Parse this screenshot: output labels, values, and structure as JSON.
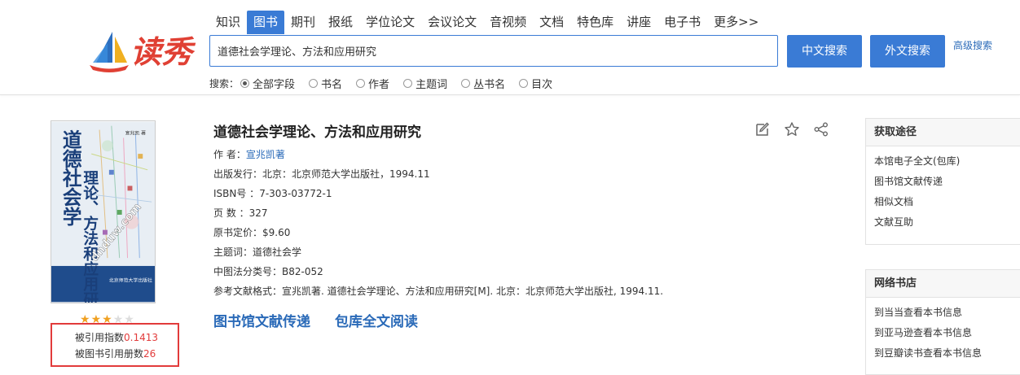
{
  "nav": {
    "items": [
      "知识",
      "图书",
      "期刊",
      "报纸",
      "学位论文",
      "会议论文",
      "音视频",
      "文档",
      "特色库",
      "讲座",
      "电子书",
      "更多>>"
    ],
    "active_index": 1
  },
  "logo": {
    "text": "读秀"
  },
  "search": {
    "value": "道德社会学理论、方法和应用研究",
    "cn_button": "中文搜索",
    "foreign_button": "外文搜索",
    "advanced_link": "高级搜索",
    "fields_label": "搜索：",
    "fields": [
      "全部字段",
      "书名",
      "作者",
      "主题词",
      "丛书名",
      "目次"
    ],
    "selected_field_index": 0
  },
  "book": {
    "title": "道德社会学理论、方法和应用研究",
    "author_label": "作 者：",
    "author": "宣兆凯著",
    "publisher_label": "出版发行：",
    "publisher": "北京：北京师范大学出版社，1994.11",
    "isbn_label": "ISBN号 ：",
    "isbn": "7-303-03772-1",
    "pages_label": "页 数 ：",
    "pages": "327",
    "price_label": "原书定价：",
    "price": "$9.60",
    "subject_label": "主题词：",
    "subject": "道德社会学",
    "clc_label": "中图法分类号：",
    "clc": "B82-052",
    "ref_label": "参考文献格式：",
    "ref": "宣兆凯著. 道德社会学理论、方法和应用研究[M]. 北京：北京师范大学出版社, 1994.11.",
    "rating": 3,
    "rating_max": 5,
    "cite_index_label": "被引用指数",
    "cite_index": "0.1413",
    "cite_books_label": "被图书引用册数",
    "cite_books": "26",
    "cover_title": "道德社会学理论、方法和应用研究",
    "cover_author": "宣兆凯 著",
    "cover_publisher": "北京师范大学出版社",
    "cover_watermark": "dnduw.com"
  },
  "actions": {
    "delivery": "图书馆文献传递",
    "read": "包库全文阅读"
  },
  "tools": [
    "edit-icon",
    "star-icon",
    "share-icon"
  ],
  "panel_access": {
    "title": "获取途径",
    "items": [
      "本馆电子全文(包库)",
      "图书馆文献传递",
      "相似文档",
      "文献互助"
    ]
  },
  "panel_stores": {
    "title": "网络书店",
    "items": [
      "到当当查看本书信息",
      "到亚马逊查看本书信息",
      "到豆瓣读书查看本书信息"
    ]
  },
  "colors": {
    "primary": "#3a7bd5",
    "link": "#2a6ab8",
    "highlight": "#e23b3b",
    "star": "#f0a020"
  }
}
